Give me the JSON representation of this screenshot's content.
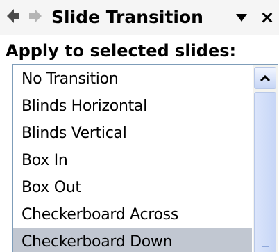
{
  "panel": {
    "title": "Slide Transition",
    "close_glyph": "×",
    "icons": {
      "back": "back-arrow-icon",
      "forward": "forward-arrow-icon",
      "menu": "dropdown-triangle-icon",
      "scroll_up": "chevron-up-icon"
    }
  },
  "section": {
    "label": "Apply to selected slides:"
  },
  "transitions": {
    "items": [
      {
        "label": "No Transition"
      },
      {
        "label": "Blinds Horizontal"
      },
      {
        "label": "Blinds Vertical"
      },
      {
        "label": "Box In"
      },
      {
        "label": "Box Out"
      },
      {
        "label": "Checkerboard Across"
      },
      {
        "label": "Checkerboard Down"
      }
    ],
    "selected": "Checkerboard Down"
  },
  "colors": {
    "selection": "#c1c7d1",
    "list_border": "#7f9db9",
    "nav_back": "#4a4a4a",
    "nav_forward": "#b5b5b5"
  }
}
